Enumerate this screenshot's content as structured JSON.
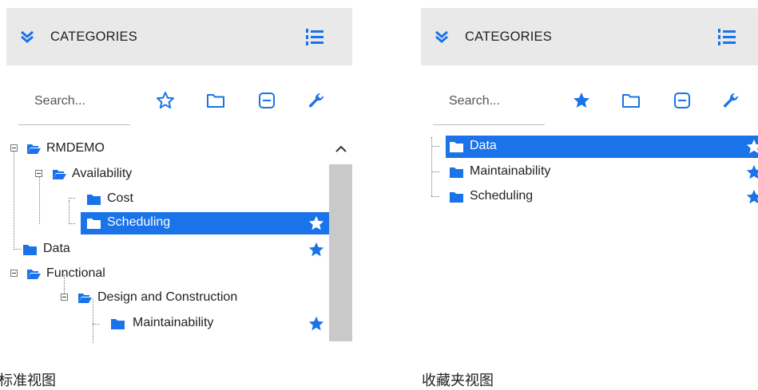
{
  "left_panel": {
    "header_title": "CATEGORIES",
    "search_placeholder": "Search...",
    "tree": [
      {
        "label": "RMDEMO"
      },
      {
        "label": "Availability"
      },
      {
        "label": "Cost"
      },
      {
        "label": "Scheduling",
        "selected": true,
        "favorite": true
      },
      {
        "label": "Data",
        "favorite": true
      },
      {
        "label": "Functional"
      },
      {
        "label": "Design and Construction"
      },
      {
        "label": "Maintainability",
        "favorite": true
      }
    ],
    "caption": "标准视图"
  },
  "right_panel": {
    "header_title": "CATEGORIES",
    "search_placeholder": "Search...",
    "tree": [
      {
        "label": "Data",
        "selected": true,
        "favorite": true
      },
      {
        "label": "Maintainability",
        "favorite": true
      },
      {
        "label": "Scheduling",
        "favorite": true
      }
    ],
    "caption": "收藏夹视图"
  },
  "colors": {
    "accent": "#1a73e8",
    "header_bg": "#e9e9ea",
    "scroll_thumb": "#c9c9c9"
  },
  "icons": [
    "chevron-double-down-icon",
    "list-numbered-icon",
    "star-outline-icon",
    "star-filled-icon",
    "folder-outline-icon",
    "collapse-icon",
    "wrench-icon",
    "folder-icon",
    "folder-open-icon",
    "chevron-up-icon"
  ]
}
